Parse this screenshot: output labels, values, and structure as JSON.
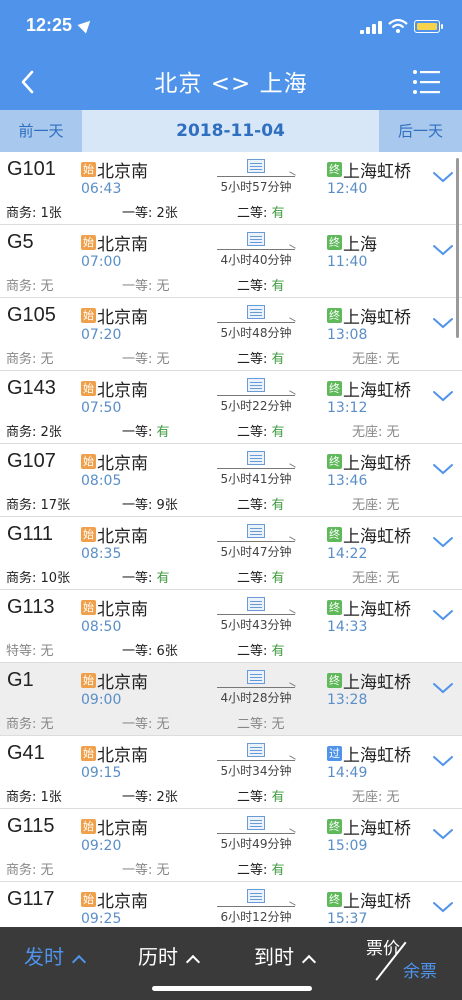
{
  "status_bar": {
    "time": "12:25"
  },
  "nav": {
    "title": "北京 <> 上海"
  },
  "datebar": {
    "prev_label": "前一天",
    "date": "2018-11-04",
    "next_label": "后一天"
  },
  "badges": {
    "start": "始",
    "end": "终",
    "pass": "过"
  },
  "colors": {
    "header": "#4f93ea",
    "start_badge": "#f0a04b",
    "end_badge": "#5fb85a",
    "pass_badge": "#4f93ea",
    "available": "#3f9a3f"
  },
  "trains": [
    {
      "no": "G101",
      "from": "北京南",
      "dep": "06:43",
      "to": "上海虹桥",
      "arr": "12:40",
      "end_type": "end",
      "duration": "5小时57分钟",
      "seats": [
        {
          "label": "商务:",
          "value": "1张"
        },
        {
          "label": "一等:",
          "value": "2张"
        },
        {
          "label": "二等:",
          "value": "有"
        }
      ]
    },
    {
      "no": "G5",
      "from": "北京南",
      "dep": "07:00",
      "to": "上海",
      "arr": "11:40",
      "end_type": "end",
      "duration": "4小时40分钟",
      "seats": [
        {
          "label": "商务:",
          "value": "无"
        },
        {
          "label": "一等:",
          "value": "无"
        },
        {
          "label": "二等:",
          "value": "有"
        }
      ]
    },
    {
      "no": "G105",
      "from": "北京南",
      "dep": "07:20",
      "to": "上海虹桥",
      "arr": "13:08",
      "end_type": "end",
      "duration": "5小时48分钟",
      "seats": [
        {
          "label": "商务:",
          "value": "无"
        },
        {
          "label": "一等:",
          "value": "无"
        },
        {
          "label": "二等:",
          "value": "有"
        },
        {
          "label": "无座:",
          "value": "无"
        }
      ]
    },
    {
      "no": "G143",
      "from": "北京南",
      "dep": "07:50",
      "to": "上海虹桥",
      "arr": "13:12",
      "end_type": "end",
      "duration": "5小时22分钟",
      "seats": [
        {
          "label": "商务:",
          "value": "2张"
        },
        {
          "label": "一等:",
          "value": "有"
        },
        {
          "label": "二等:",
          "value": "有"
        },
        {
          "label": "无座:",
          "value": "无"
        }
      ]
    },
    {
      "no": "G107",
      "from": "北京南",
      "dep": "08:05",
      "to": "上海虹桥",
      "arr": "13:46",
      "end_type": "end",
      "duration": "5小时41分钟",
      "seats": [
        {
          "label": "商务:",
          "value": "17张"
        },
        {
          "label": "一等:",
          "value": "9张"
        },
        {
          "label": "二等:",
          "value": "有"
        },
        {
          "label": "无座:",
          "value": "无"
        }
      ]
    },
    {
      "no": "G111",
      "from": "北京南",
      "dep": "08:35",
      "to": "上海虹桥",
      "arr": "14:22",
      "end_type": "end",
      "duration": "5小时47分钟",
      "seats": [
        {
          "label": "商务:",
          "value": "10张"
        },
        {
          "label": "一等:",
          "value": "有"
        },
        {
          "label": "二等:",
          "value": "有"
        },
        {
          "label": "无座:",
          "value": "无"
        }
      ]
    },
    {
      "no": "G113",
      "from": "北京南",
      "dep": "08:50",
      "to": "上海虹桥",
      "arr": "14:33",
      "end_type": "end",
      "duration": "5小时43分钟",
      "seats": [
        {
          "label": "特等:",
          "value": "无"
        },
        {
          "label": "一等:",
          "value": "6张"
        },
        {
          "label": "二等:",
          "value": "有"
        }
      ]
    },
    {
      "no": "G1",
      "from": "北京南",
      "dep": "09:00",
      "to": "上海虹桥",
      "arr": "13:28",
      "end_type": "end",
      "duration": "4小时28分钟",
      "highlight": true,
      "seats": [
        {
          "label": "商务:",
          "value": "无"
        },
        {
          "label": "一等:",
          "value": "无"
        },
        {
          "label": "二等:",
          "value": "无"
        }
      ]
    },
    {
      "no": "G41",
      "from": "北京南",
      "dep": "09:15",
      "to": "上海虹桥",
      "arr": "14:49",
      "end_type": "pass",
      "duration": "5小时34分钟",
      "seats": [
        {
          "label": "商务:",
          "value": "1张"
        },
        {
          "label": "一等:",
          "value": "2张"
        },
        {
          "label": "二等:",
          "value": "有"
        },
        {
          "label": "无座:",
          "value": "无"
        }
      ]
    },
    {
      "no": "G115",
      "from": "北京南",
      "dep": "09:20",
      "to": "上海虹桥",
      "arr": "15:09",
      "end_type": "end",
      "duration": "5小时49分钟",
      "seats": [
        {
          "label": "商务:",
          "value": "无"
        },
        {
          "label": "一等:",
          "value": "无"
        },
        {
          "label": "二等:",
          "value": "有"
        }
      ]
    },
    {
      "no": "G117",
      "from": "北京南",
      "dep": "09:25",
      "to": "上海虹桥",
      "arr": "15:37",
      "end_type": "end",
      "duration": "6小时12分钟",
      "seats": []
    }
  ],
  "bottom": {
    "depart_label": "发时",
    "duration_label": "历时",
    "arrive_label": "到时",
    "price_label": "票价",
    "remaining_label": "余票"
  }
}
